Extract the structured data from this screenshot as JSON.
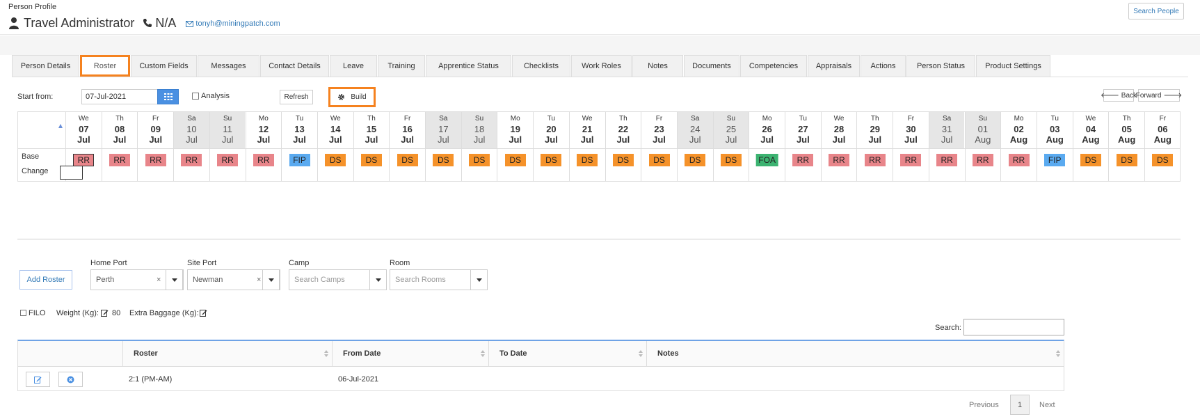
{
  "header": {
    "section_label": "Person Profile",
    "person_name": "Travel Administrator",
    "phone": "N/A",
    "email": "tonyh@miningpatch.com",
    "search_people": "Search People"
  },
  "tabs": [
    {
      "label": "Person Details"
    },
    {
      "label": "Roster",
      "active": true
    },
    {
      "label": "Custom Fields"
    },
    {
      "label": "Messages"
    },
    {
      "label": "Contact Details"
    },
    {
      "label": "Leave"
    },
    {
      "label": "Training"
    },
    {
      "label": "Apprentice Status"
    },
    {
      "label": "Checklists"
    },
    {
      "label": "Work Roles"
    },
    {
      "label": "Notes"
    },
    {
      "label": "Documents"
    },
    {
      "label": "Competencies"
    },
    {
      "label": "Appraisals"
    },
    {
      "label": "Actions"
    },
    {
      "label": "Person Status"
    },
    {
      "label": "Product Settings"
    }
  ],
  "toolbar": {
    "start_label": "Start from:",
    "start_date": "07-Jul-2021",
    "analysis_label": "Analysis",
    "refresh_label": "Refresh",
    "build_label": "Build",
    "back_label": "Back",
    "forward_label": "Forward"
  },
  "grid": {
    "base_label": "Base",
    "change_label": "Change",
    "days": [
      {
        "dow": "We",
        "day": "07",
        "mon": "Jul",
        "code": "RR"
      },
      {
        "dow": "Th",
        "day": "08",
        "mon": "Jul",
        "code": "RR"
      },
      {
        "dow": "Fr",
        "day": "09",
        "mon": "Jul",
        "code": "RR"
      },
      {
        "dow": "Sa",
        "day": "10",
        "mon": "Jul",
        "code": "RR",
        "weekend": true
      },
      {
        "dow": "Su",
        "day": "11",
        "mon": "Jul",
        "code": "RR",
        "weekend": true
      },
      {
        "dow": "Mo",
        "day": "12",
        "mon": "Jul",
        "code": "RR"
      },
      {
        "dow": "Tu",
        "day": "13",
        "mon": "Jul",
        "code": "FIP"
      },
      {
        "dow": "We",
        "day": "14",
        "mon": "Jul",
        "code": "DS"
      },
      {
        "dow": "Th",
        "day": "15",
        "mon": "Jul",
        "code": "DS"
      },
      {
        "dow": "Fr",
        "day": "16",
        "mon": "Jul",
        "code": "DS"
      },
      {
        "dow": "Sa",
        "day": "17",
        "mon": "Jul",
        "code": "DS",
        "weekend": true
      },
      {
        "dow": "Su",
        "day": "18",
        "mon": "Jul",
        "code": "DS",
        "weekend": true
      },
      {
        "dow": "Mo",
        "day": "19",
        "mon": "Jul",
        "code": "DS"
      },
      {
        "dow": "Tu",
        "day": "20",
        "mon": "Jul",
        "code": "DS"
      },
      {
        "dow": "We",
        "day": "21",
        "mon": "Jul",
        "code": "DS"
      },
      {
        "dow": "Th",
        "day": "22",
        "mon": "Jul",
        "code": "DS"
      },
      {
        "dow": "Fr",
        "day": "23",
        "mon": "Jul",
        "code": "DS"
      },
      {
        "dow": "Sa",
        "day": "24",
        "mon": "Jul",
        "code": "DS",
        "weekend": true
      },
      {
        "dow": "Su",
        "day": "25",
        "mon": "Jul",
        "code": "DS",
        "weekend": true
      },
      {
        "dow": "Mo",
        "day": "26",
        "mon": "Jul",
        "code": "FOA"
      },
      {
        "dow": "Tu",
        "day": "27",
        "mon": "Jul",
        "code": "RR"
      },
      {
        "dow": "We",
        "day": "28",
        "mon": "Jul",
        "code": "RR"
      },
      {
        "dow": "Th",
        "day": "29",
        "mon": "Jul",
        "code": "RR"
      },
      {
        "dow": "Fr",
        "day": "30",
        "mon": "Jul",
        "code": "RR"
      },
      {
        "dow": "Sa",
        "day": "31",
        "mon": "Jul",
        "code": "RR",
        "weekend": true
      },
      {
        "dow": "Su",
        "day": "01",
        "mon": "Aug",
        "code": "RR",
        "weekend": true
      },
      {
        "dow": "Mo",
        "day": "02",
        "mon": "Aug",
        "code": "RR"
      },
      {
        "dow": "Tu",
        "day": "03",
        "mon": "Aug",
        "code": "FIP"
      },
      {
        "dow": "We",
        "day": "04",
        "mon": "Aug",
        "code": "DS"
      },
      {
        "dow": "Th",
        "day": "05",
        "mon": "Aug",
        "code": "DS"
      },
      {
        "dow": "Fr",
        "day": "06",
        "mon": "Aug",
        "code": "DS"
      }
    ],
    "code_colors": {
      "RR": "#e8858a",
      "DS": "#f5922a",
      "FIP": "#5aaaf0",
      "FOA": "#3cb371"
    }
  },
  "form": {
    "add_roster": "Add Roster",
    "home_port_label": "Home Port",
    "home_port_value": "Perth",
    "site_port_label": "Site Port",
    "site_port_value": "Newman",
    "camp_label": "Camp",
    "camp_placeholder": "Search Camps",
    "room_label": "Room",
    "room_placeholder": "Search Rooms",
    "filo_label": "FILO",
    "weight_label": "Weight (Kg):",
    "weight_value": "80",
    "baggage_label": "Extra Baggage (Kg):",
    "clear_glyph": "×"
  },
  "table": {
    "search_label": "Search:",
    "columns": [
      "Roster",
      "From Date",
      "To Date",
      "Notes"
    ],
    "rows": [
      {
        "roster": "2:1 (PM-AM)",
        "from": "06-Jul-2021",
        "to": "",
        "notes": ""
      }
    ]
  },
  "pager": {
    "previous": "Previous",
    "page": "1",
    "next": "Next"
  },
  "colors": {
    "accent": "#f5821f",
    "primary": "#4a90e2",
    "link": "#337ab7"
  }
}
